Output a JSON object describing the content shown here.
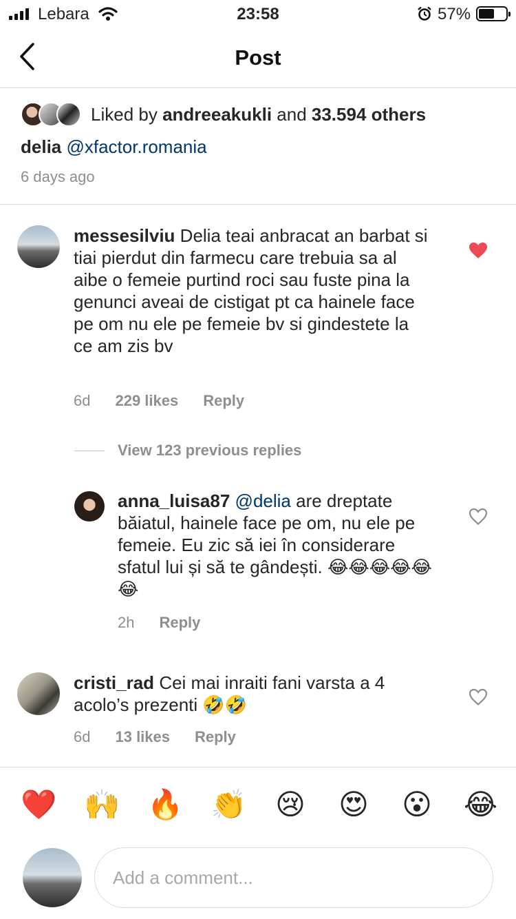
{
  "status": {
    "carrier": "Lebara",
    "time": "23:58",
    "battery": "57%",
    "battery_level": 0.57
  },
  "nav": {
    "title": "Post",
    "back_icon": "chevron-left-icon"
  },
  "post": {
    "liked_prefix": "Liked by ",
    "liked_user": "andreeakukli",
    "liked_and": " and ",
    "liked_others": "33.594 others",
    "caption_user": "delia",
    "caption_mention": "@xfactor.romania",
    "posted": "6 days ago"
  },
  "comments": [
    {
      "user": "messesilviu",
      "text": "Delia teai anbracat an barbat si tiai pierdut din farmecu care trebuia sa al aibe o femeie purtind roci sau fuste pina la genunci aveai de cistigat pt ca hainele face pe om nu ele pe femeie bv si gindestete la ce am zis bv",
      "time": "6d",
      "likes": "229 likes",
      "reply": "Reply",
      "liked": true,
      "heart_color": "#ed4956"
    },
    {
      "user": "anna_luisa87",
      "mention": "@delia",
      "text": "are dreptate băiatul, hainele face pe om, nu ele pe femeie. Eu zic să iei în considerare sfatul lui și să te gândești. 😂😂😂😂😂😂",
      "time": "2h",
      "reply": "Reply",
      "liked": false
    },
    {
      "user": "cristi_rad",
      "text": "Cei mai inraiti fani varsta a 4 acolo’s prezenti 🤣🤣",
      "time": "6d",
      "likes": "13 likes",
      "reply": "Reply",
      "liked": false
    }
  ],
  "view_replies": "View 123 previous replies",
  "emojis": [
    "❤️",
    "🙌",
    "🔥",
    "👏",
    "😢",
    "😍",
    "😮",
    "😂"
  ],
  "composer": {
    "placeholder": "Add a comment..."
  },
  "colors": {
    "link": "#00376b",
    "secondary": "#8e8e8e",
    "heart_red": "#ed4956",
    "divider": "#dbdbdb"
  }
}
